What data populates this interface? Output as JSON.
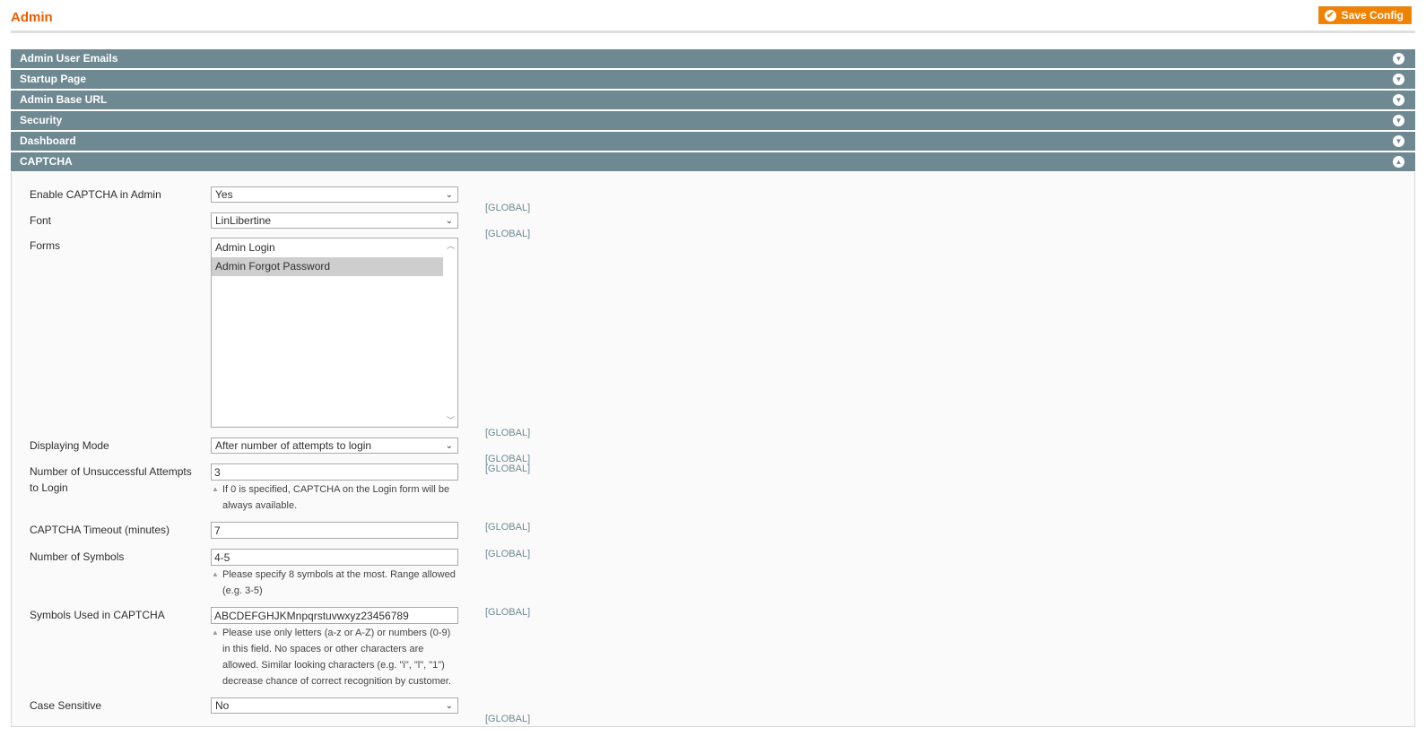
{
  "page": {
    "title": "Admin"
  },
  "toolbar": {
    "save_label": "Save Config",
    "accent_color": "#f18200"
  },
  "sections": [
    {
      "label": "Admin User Emails",
      "state": "collapsed"
    },
    {
      "label": "Startup Page",
      "state": "collapsed"
    },
    {
      "label": "Admin Base URL",
      "state": "collapsed"
    },
    {
      "label": "Security",
      "state": "collapsed"
    },
    {
      "label": "Dashboard",
      "state": "collapsed"
    },
    {
      "label": "CAPTCHA",
      "state": "expanded"
    }
  ],
  "captcha": {
    "enable": {
      "label": "Enable CAPTCHA in Admin",
      "value": "Yes",
      "scope": "[GLOBAL]"
    },
    "font": {
      "label": "Font",
      "value": "LinLibertine",
      "scope": "[GLOBAL]"
    },
    "forms": {
      "label": "Forms",
      "options": [
        "Admin Login",
        "Admin Forgot Password"
      ],
      "selected": "Admin Forgot Password",
      "scope": "[GLOBAL]"
    },
    "mode": {
      "label": "Displaying Mode",
      "value": "After number of attempts to login",
      "scope": "[GLOBAL]"
    },
    "attempts": {
      "label": "Number of Unsuccessful Attempts to Login",
      "value": "3",
      "note": "If 0 is specified, CAPTCHA on the Login form will be always available.",
      "scope": "[GLOBAL]"
    },
    "timeout": {
      "label": "CAPTCHA Timeout (minutes)",
      "value": "7",
      "scope": "[GLOBAL]"
    },
    "symbols_count": {
      "label": "Number of Symbols",
      "value": "4-5",
      "note": "Please specify 8 symbols at the most. Range allowed (e.g. 3-5)",
      "scope": "[GLOBAL]"
    },
    "symbols_used": {
      "label": "Symbols Used in CAPTCHA",
      "value": "ABCDEFGHJKMnpqrstuvwxyz23456789",
      "note": "Please use only letters (a-z or A-Z) or numbers (0-9) in this field. No spaces or other characters are allowed. Similar looking characters (e.g. \"i\", \"l\", \"1\") decrease chance of correct recognition by customer.",
      "scope": "[GLOBAL]"
    },
    "case_sensitive": {
      "label": "Case Sensitive",
      "value": "No",
      "scope": "[GLOBAL]"
    }
  }
}
